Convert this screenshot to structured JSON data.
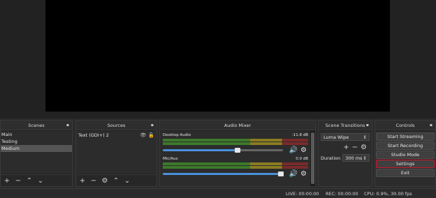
{
  "docks": {
    "scenes": {
      "title": "Scenes",
      "items": [
        "Main",
        "Testing",
        "Medium"
      ],
      "selected_index": 2
    },
    "sources": {
      "title": "Sources",
      "items": [
        {
          "label": "Text (GDI+) 2"
        }
      ]
    },
    "mixer": {
      "title": "Audio Mixer",
      "channels": [
        {
          "name": "Desktop Audio",
          "level": "-11.8 dB",
          "volume_fraction": 0.62
        },
        {
          "name": "Mic/Aux",
          "level": "0.0 dB",
          "volume_fraction": 0.98
        }
      ],
      "scale": [
        "-60",
        "-55",
        "-50",
        "-45",
        "-40",
        "-35",
        "-30",
        "-25",
        "-20",
        "-15",
        "-10",
        "-5",
        "0"
      ]
    },
    "transitions": {
      "title": "Scene Transitions",
      "selected": "Luma Wipe",
      "duration_label": "Duration",
      "duration_value": "300 ms"
    },
    "controls": {
      "title": "Controls",
      "buttons": [
        "Start Streaming",
        "Start Recording",
        "Studio Mode",
        "Settings",
        "Exit"
      ],
      "highlighted_index": 3,
      "highlight_color": "#d0152c"
    }
  },
  "status": {
    "live": "LIVE: 00:00:00",
    "rec": "REC: 00:00:00",
    "cpu": "CPU: 0.9%, 30.00 fps"
  },
  "float_glyph": "▪"
}
